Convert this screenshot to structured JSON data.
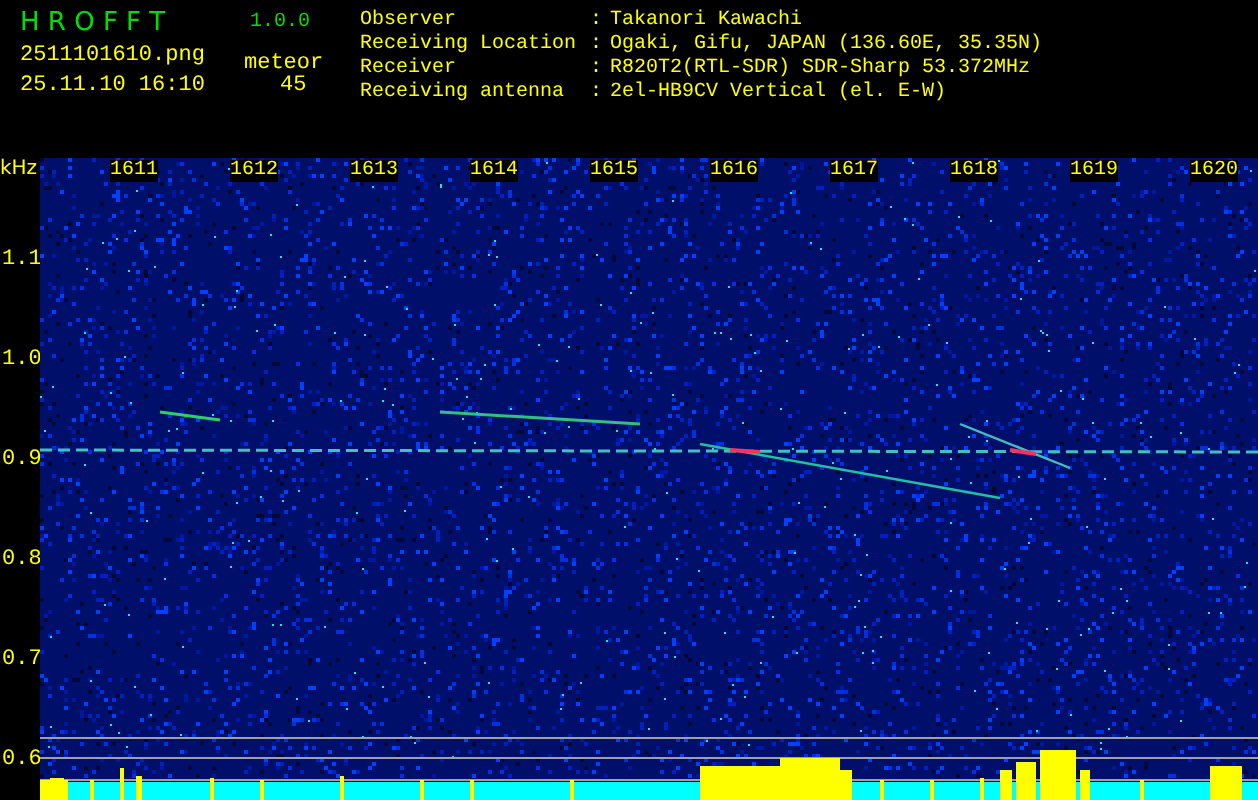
{
  "app": {
    "name": "H R O F F T",
    "version": "1.0.0"
  },
  "file": {
    "name": "2511101610.png",
    "datetime": "25.11.10 16:10"
  },
  "detection": {
    "label": "meteor",
    "count": "45"
  },
  "station": [
    {
      "label": "Observer",
      "separator": ":",
      "value": "Takanori Kawachi"
    },
    {
      "label": "Receiving Location",
      "separator": ":",
      "value": "Ogaki, Gifu, JAPAN (136.60E, 35.35N)"
    },
    {
      "label": "Receiver",
      "separator": ":",
      "value": "R820T2(RTL-SDR) SDR-Sharp 53.372MHz"
    },
    {
      "label": "Receiving antenna",
      "separator": ":",
      "value": "2el-HB9CV Vertical (el. E-W)"
    }
  ],
  "spectrogram": {
    "unit": "kHz",
    "frequency_labels": [
      "1.1",
      "1.0",
      "0.9",
      "0.8",
      "0.7",
      "0.6"
    ],
    "time_labels": [
      "1611",
      "1612",
      "1613",
      "1614",
      "1615",
      "1616",
      "1617",
      "1618",
      "1619",
      "1620"
    ]
  }
}
